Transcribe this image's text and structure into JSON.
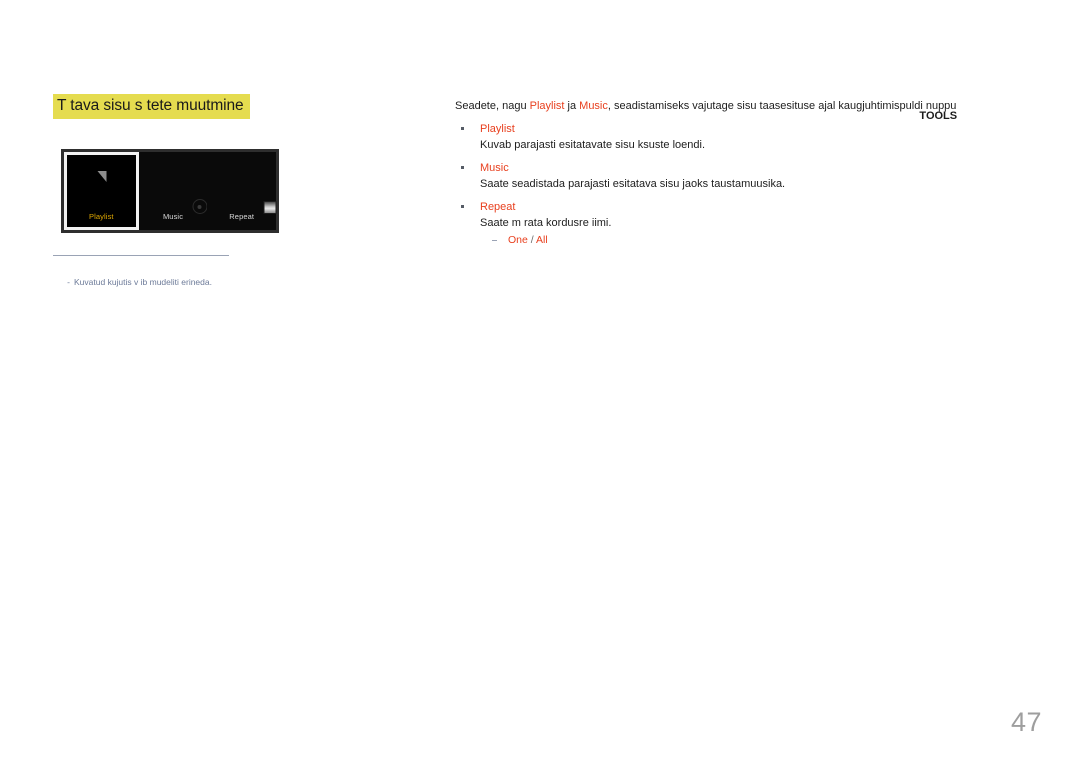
{
  "document": {
    "page_number": "47"
  },
  "section": {
    "title": "T tava sisu s tete muutmine"
  },
  "device_mockup": {
    "items": [
      {
        "label": "Playlist",
        "icon": "playlist-icon",
        "selected": true
      },
      {
        "label": "Music",
        "icon": "music-disc-icon",
        "selected": false
      },
      {
        "label": "Repeat",
        "icon": "repeat-square-icon",
        "selected": false
      }
    ]
  },
  "figure_caption": {
    "dash": "-",
    "text": "Kuvatud kujutis v ib mudeliti erineda."
  },
  "body": {
    "intro": {
      "part1": "Seadete, nagu ",
      "key1": "Playlist",
      "part2": " ja ",
      "key2": "Music",
      "part3": ", seadistamiseks vajutage sisu taasesituse ajal kaugjuhtimispuldi nuppu",
      "overlap_label": "TOOLS"
    },
    "bullets": [
      {
        "title": "Playlist",
        "desc": "Kuvab parajasti esitatavate sisu ksuste loendi."
      },
      {
        "title": "Music",
        "desc": "Saate seadistada parajasti esitatava sisu jaoks taustamuusika."
      },
      {
        "title": "Repeat",
        "desc": "Saate m rata kordusre iimi.",
        "sub": {
          "dash": "-",
          "option1": "One",
          "separator": " / ",
          "option2": "All"
        }
      }
    ]
  },
  "colors": {
    "highlight": "#e5dc4f",
    "accent": "#e8401f",
    "caption": "#6d7b99",
    "page_number": "#9e9e9e",
    "selected_label": "#e0a800"
  }
}
